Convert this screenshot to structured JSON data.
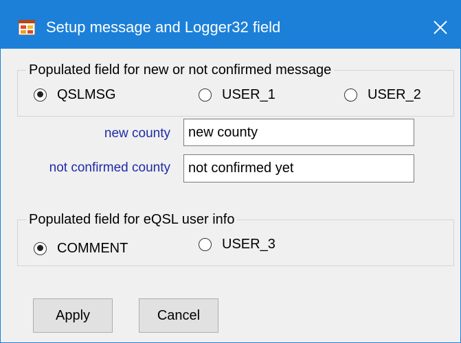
{
  "window": {
    "title": "Setup message and Logger32 field"
  },
  "message_group": {
    "legend": "Populated field for new or not confirmed message",
    "options": [
      "QSLMSG",
      "USER_1",
      "USER_2"
    ],
    "selected": "QSLMSG"
  },
  "fields": {
    "new_county": {
      "label": "new county",
      "value": "new county"
    },
    "not_confirmed_county": {
      "label": "not confirmed county",
      "value": "not confirmed yet"
    }
  },
  "eqsl_group": {
    "legend": "Populated field for eQSL user info",
    "options": [
      "COMMENT",
      "USER_3"
    ],
    "selected": "COMMENT"
  },
  "buttons": {
    "apply": "Apply",
    "cancel": "Cancel"
  },
  "colors": {
    "titlebar": "#1c80d8",
    "label_text": "#1f2aa8"
  }
}
